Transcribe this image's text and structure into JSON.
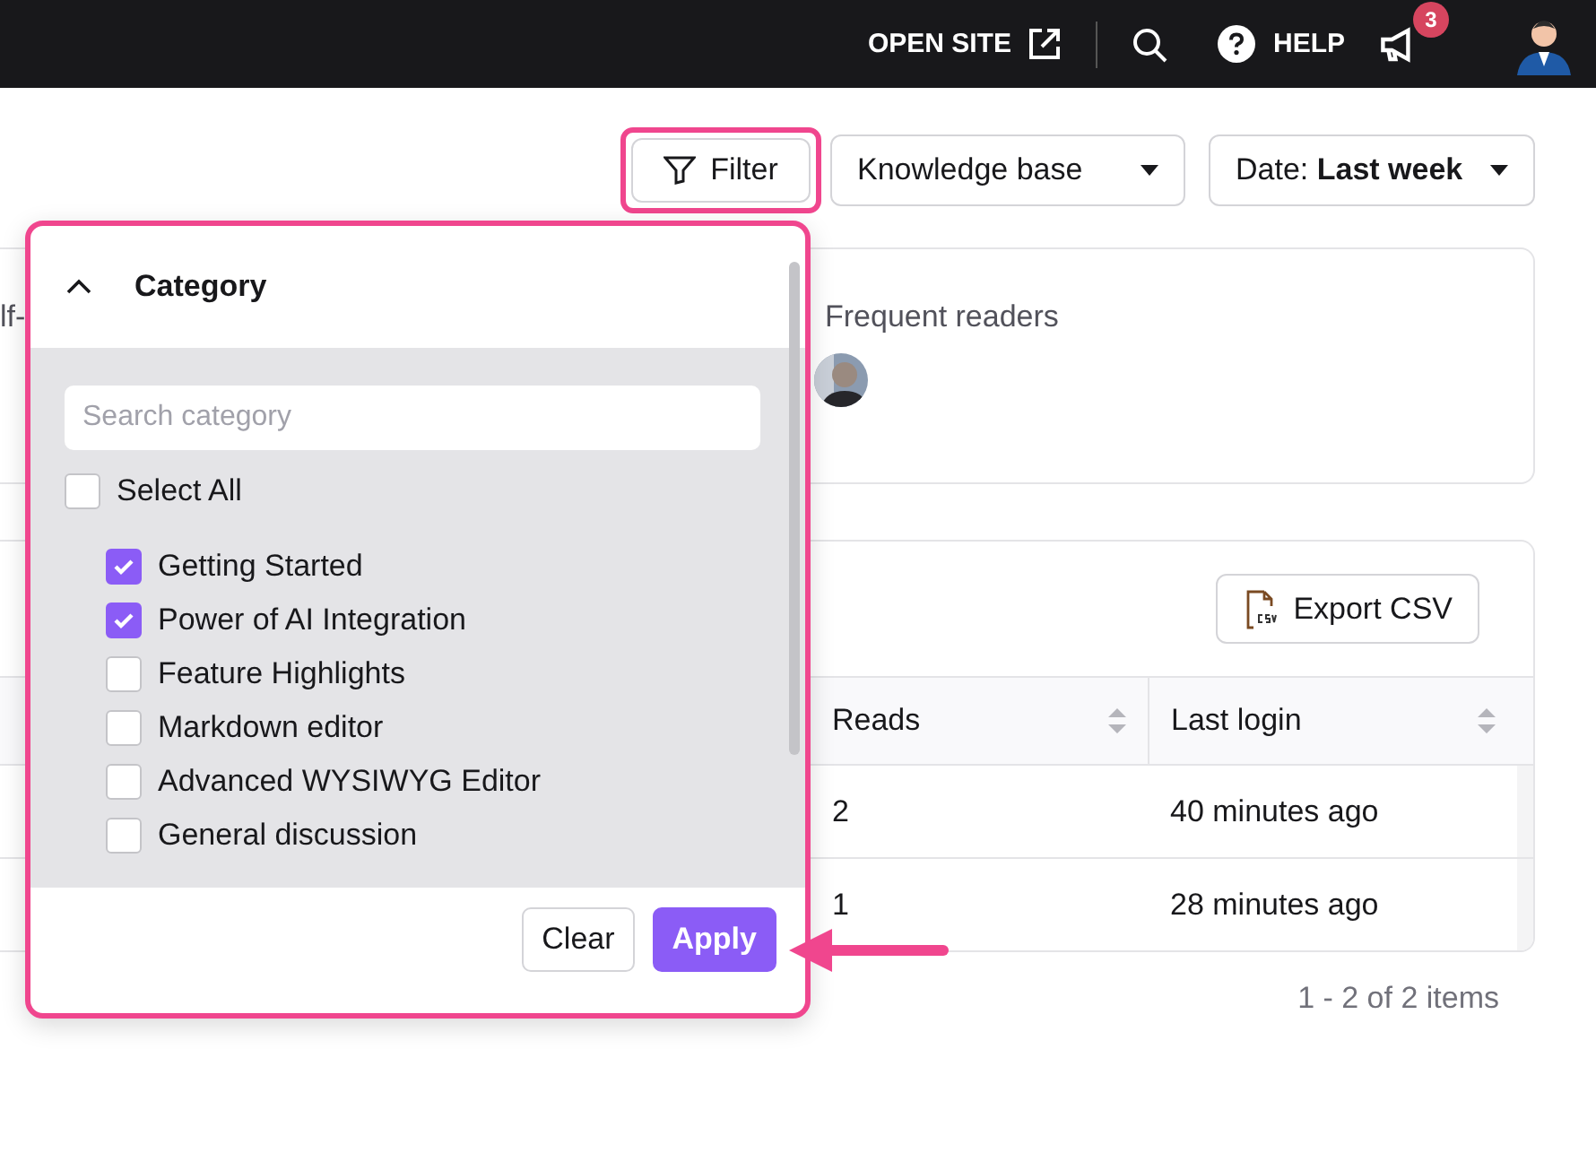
{
  "topbar": {
    "open_site": "OPEN SITE",
    "help": "HELP",
    "notification_count": "3"
  },
  "toolbar": {
    "filter": {
      "label": "Filter",
      "highlighted": true
    },
    "type_dropdown": "Knowledge base",
    "date_dropdown": "Date: **Last week**"
  },
  "summary_card": {
    "column_1": "lf-",
    "frequent_readers": "Frequent readers"
  },
  "table_card": {
    "export_button": "Export CSV",
    "columns": [
      "Reads",
      "Last login"
    ],
    "rows": [
      [
        "2",
        "40 minutes ago"
      ],
      [
        "1",
        "28 minutes ago"
      ]
    ],
    "pagination": "1 - 2 of 2 items"
  },
  "filter_popup": {
    "section": {
      "title": "Category",
      "expanded": true
    },
    "search": {
      "placeholder": "Search category"
    },
    "select_all": {
      "label": "Select All",
      "checked": false
    },
    "categories": [
      {
        "label": "Getting Started",
        "checked": true
      },
      {
        "label": "Power of AI Integration",
        "checked": true
      },
      {
        "label": "Feature Highlights",
        "checked": false
      },
      {
        "label": "Markdown editor",
        "checked": false
      },
      {
        "label": "Advanced WYSIWYG Editor",
        "checked": false
      },
      {
        "label": "General discussion",
        "checked": false
      }
    ],
    "buttons": {
      "clear": "Clear",
      "apply": "Apply"
    }
  }
}
